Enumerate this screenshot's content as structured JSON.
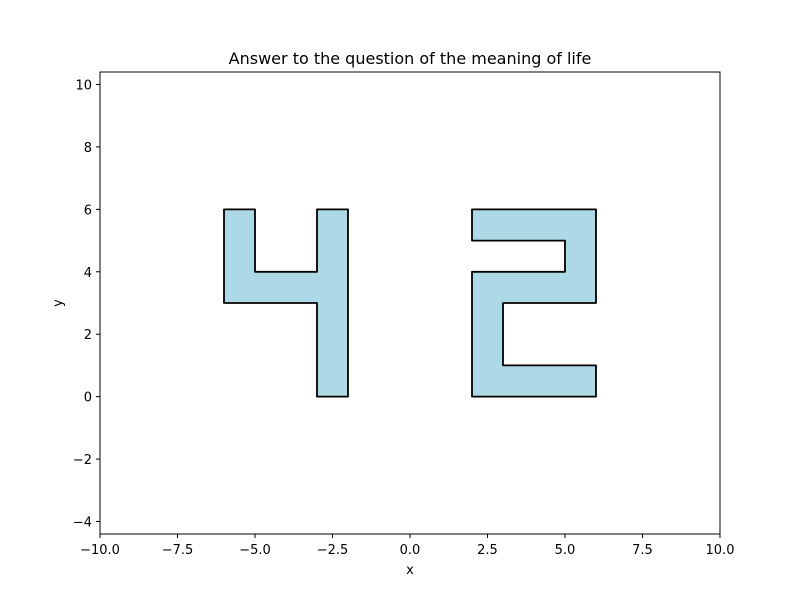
{
  "chart_data": {
    "type": "area",
    "title": "Answer to the question of the meaning of life",
    "xlabel": "x",
    "ylabel": "y",
    "xlim": [
      -10,
      10
    ],
    "ylim": [
      -4.4,
      10.4
    ],
    "xticks": [
      -10,
      -7.5,
      -5,
      -2.5,
      0,
      2.5,
      5,
      7.5,
      10
    ],
    "xtick_labels": [
      "−10.0",
      "−7.5",
      "−5.0",
      "−2.5",
      "0.0",
      "2.5",
      "5.0",
      "7.5",
      "10.0"
    ],
    "yticks": [
      -4,
      -2,
      0,
      2,
      4,
      6,
      8,
      10
    ],
    "ytick_labels": [
      "−4",
      "−2",
      "0",
      "2",
      "4",
      "6",
      "8",
      "10"
    ],
    "grid": false,
    "fill_color": "#add8e6",
    "edge_color": "#000000",
    "shapes": [
      {
        "points": [
          [
            -6,
            6
          ],
          [
            -5,
            6
          ],
          [
            -5,
            4
          ],
          [
            -3,
            4
          ],
          [
            -3,
            6
          ],
          [
            -2,
            6
          ],
          [
            -2,
            0
          ],
          [
            -3,
            0
          ],
          [
            -3,
            3
          ],
          [
            -6,
            3
          ]
        ]
      },
      {
        "points": [
          [
            2,
            6
          ],
          [
            6,
            6
          ],
          [
            6,
            3
          ],
          [
            3,
            3
          ],
          [
            3,
            1
          ],
          [
            6,
            1
          ],
          [
            6,
            0
          ],
          [
            2,
            0
          ],
          [
            2,
            4
          ],
          [
            5,
            4
          ],
          [
            5,
            5
          ],
          [
            2,
            5
          ]
        ]
      }
    ]
  }
}
